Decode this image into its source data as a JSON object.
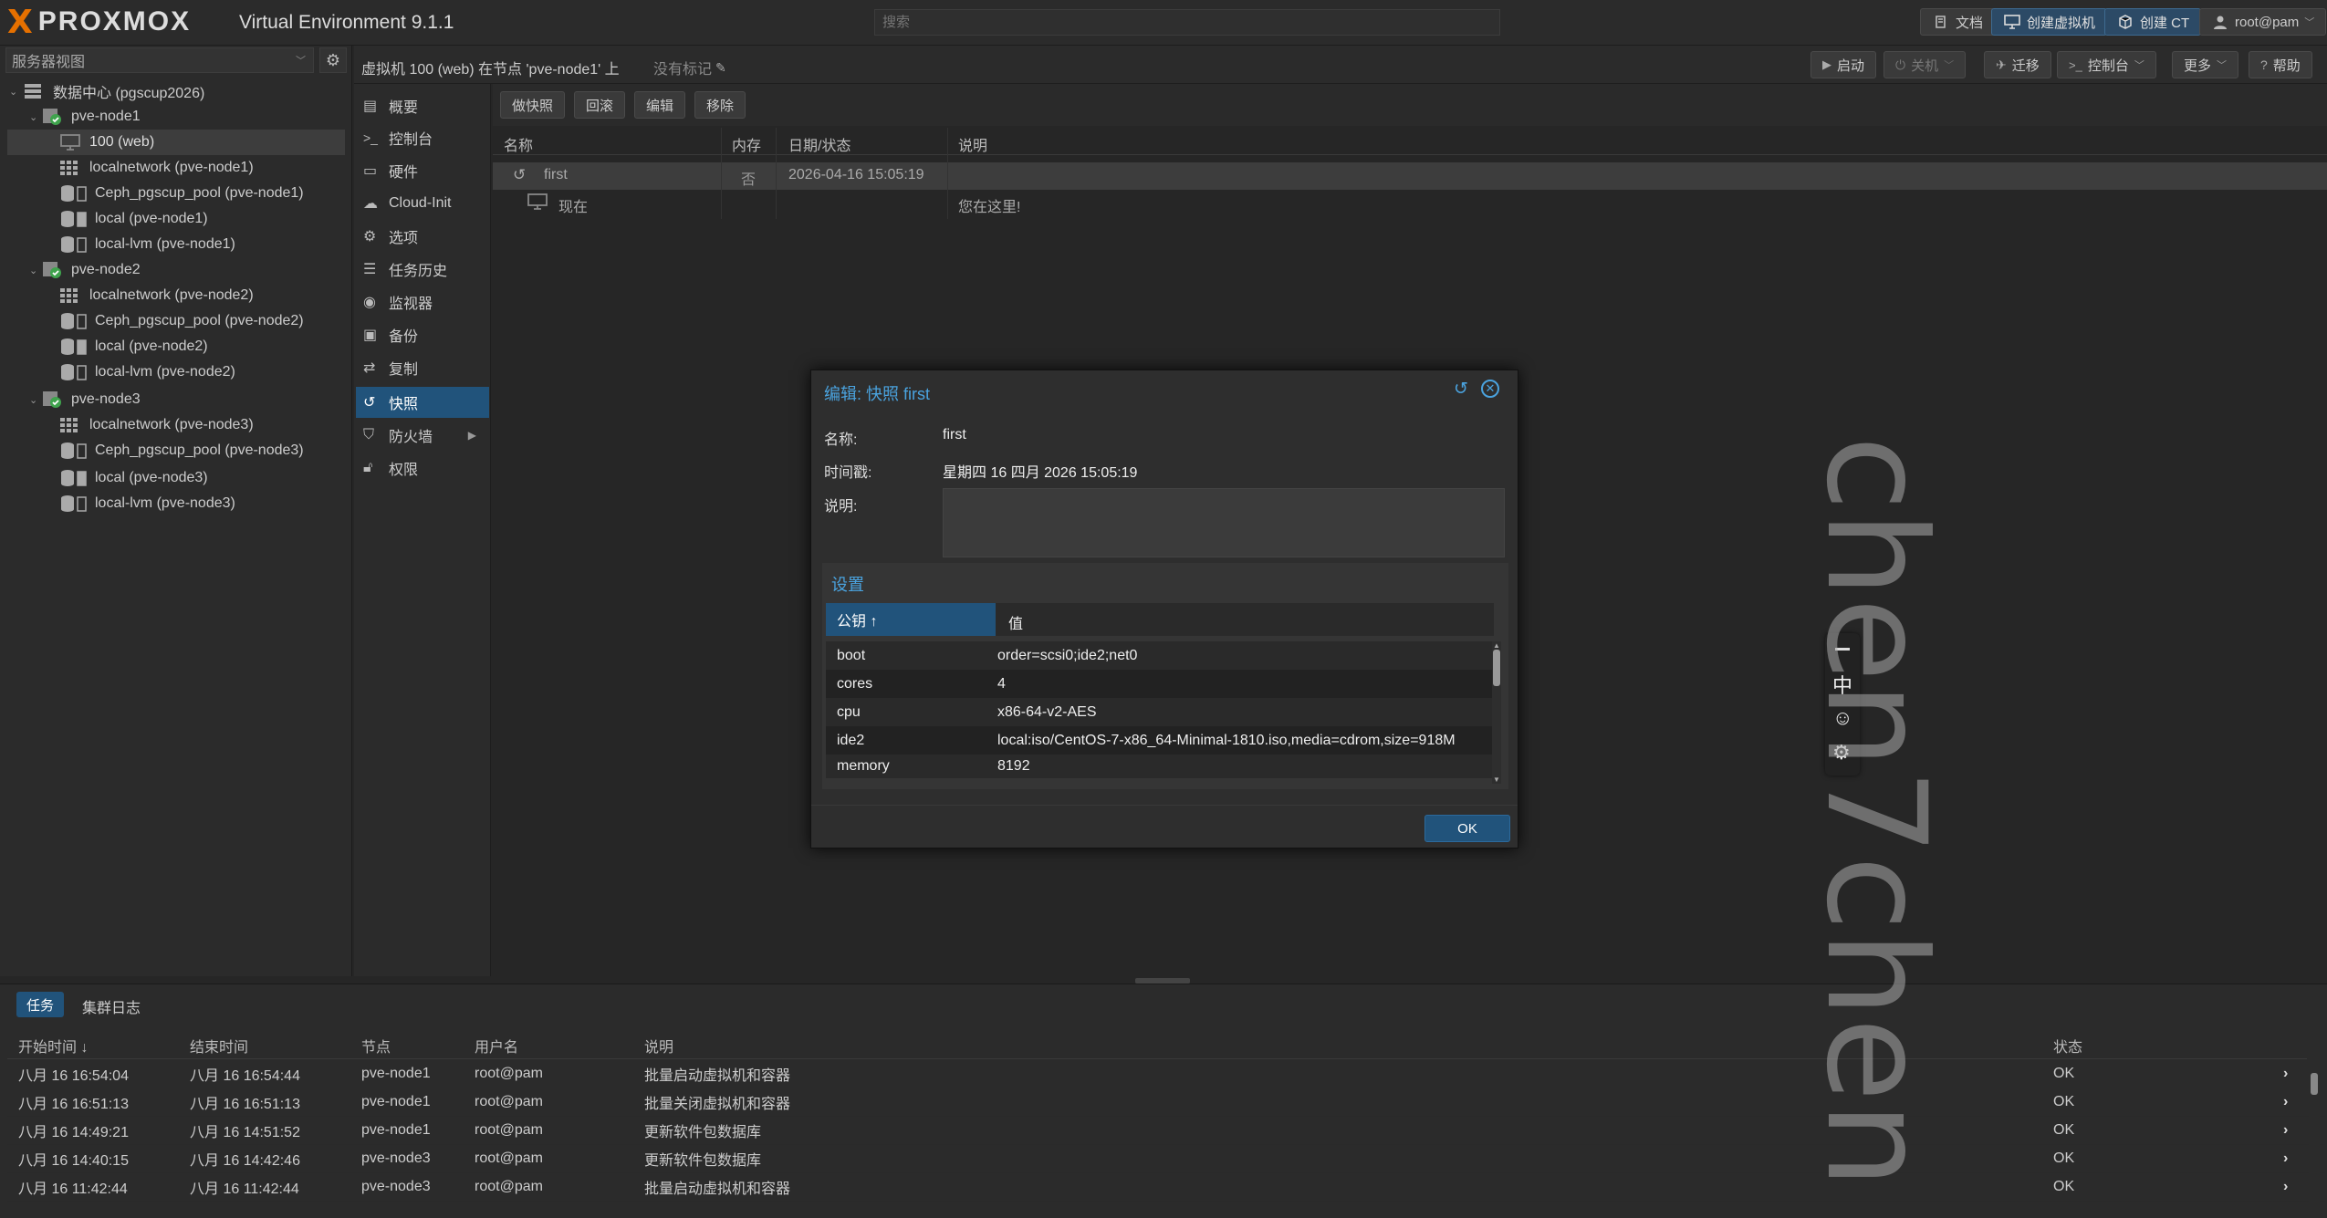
{
  "header": {
    "logo_x": "X",
    "logo_text": "PROXMOX",
    "product": "Virtual Environment 9.1.1",
    "search_placeholder": "搜索",
    "docs_label": "文档",
    "create_vm_label": "创建虚拟机",
    "create_ct_label": "创建 CT",
    "user_label": "root@pam"
  },
  "tree": {
    "view_label": "服务器视图",
    "items": [
      {
        "label": "数据中心 (pgscup2026)"
      },
      {
        "label": "pve-node1"
      },
      {
        "label": "100 (web)"
      },
      {
        "label": "localnetwork (pve-node1)"
      },
      {
        "label": "Ceph_pgscup_pool (pve-node1)"
      },
      {
        "label": "local (pve-node1)"
      },
      {
        "label": "local-lvm (pve-node1)"
      },
      {
        "label": "pve-node2"
      },
      {
        "label": "localnetwork (pve-node2)"
      },
      {
        "label": "Ceph_pgscup_pool (pve-node2)"
      },
      {
        "label": "local (pve-node2)"
      },
      {
        "label": "local-lvm (pve-node2)"
      },
      {
        "label": "pve-node3"
      },
      {
        "label": "localnetwork (pve-node3)"
      },
      {
        "label": "Ceph_pgscup_pool (pve-node3)"
      },
      {
        "label": "local (pve-node3)"
      },
      {
        "label": "local-lvm (pve-node3)"
      }
    ]
  },
  "content_header": {
    "title": "虚拟机 100 (web) 在节点 'pve-node1' 上",
    "tags": "没有标记",
    "start": "启动",
    "shutdown": "关机",
    "migrate": "迁移",
    "console": "控制台",
    "more": "更多",
    "help": "帮助"
  },
  "nav": {
    "items": [
      {
        "label": "概要"
      },
      {
        "label": "控制台"
      },
      {
        "label": "硬件"
      },
      {
        "label": "Cloud-Init"
      },
      {
        "label": "选项"
      },
      {
        "label": "任务历史"
      },
      {
        "label": "监视器"
      },
      {
        "label": "备份"
      },
      {
        "label": "复制"
      },
      {
        "label": "快照"
      },
      {
        "label": "防火墙"
      },
      {
        "label": "权限"
      }
    ]
  },
  "snapshot_toolbar": {
    "take": "做快照",
    "rollback": "回滚",
    "edit": "编辑",
    "remove": "移除"
  },
  "snapshot_table": {
    "columns": [
      "名称",
      "内存",
      "日期/状态",
      "说明"
    ],
    "rows": [
      {
        "name": "first",
        "ram": "否",
        "date": "2026-04-16 15:05:19",
        "desc": ""
      },
      {
        "name": "现在",
        "ram": "",
        "date": "",
        "desc": "您在这里!"
      }
    ]
  },
  "modal": {
    "title": "编辑: 快照 first",
    "name_label": "名称:",
    "name_value": "first",
    "time_label": "时间戳:",
    "time_value": "星期四 16 四月 2026 15:05:19",
    "desc_label": "说明:",
    "settings_title": "设置",
    "col_key": "公钥 ↑",
    "col_value": "值",
    "settings": [
      {
        "k": "boot",
        "v": "order=scsi0;ide2;net0"
      },
      {
        "k": "cores",
        "v": "4"
      },
      {
        "k": "cpu",
        "v": "x86-64-v2-AES"
      },
      {
        "k": "ide2",
        "v": "local:iso/CentOS-7-x86_64-Minimal-1810.iso,media=cdrom,size=918M"
      },
      {
        "k": "memory",
        "v": "8192"
      }
    ],
    "ok": "OK"
  },
  "ime": {
    "lang": "中"
  },
  "watermark": "chen7chen",
  "bottom": {
    "tab_tasks": "任务",
    "tab_cluster_log": "集群日志",
    "columns": {
      "start": "开始时间 ↓",
      "end": "结束时间",
      "node": "节点",
      "user": "用户名",
      "desc": "说明",
      "status": "状态"
    },
    "rows": [
      {
        "start": "八月 16 16:54:04",
        "end": "八月 16 16:54:44",
        "node": "pve-node1",
        "user": "root@pam",
        "desc": "批量启动虚拟机和容器",
        "status": "OK"
      },
      {
        "start": "八月 16 16:51:13",
        "end": "八月 16 16:51:13",
        "node": "pve-node1",
        "user": "root@pam",
        "desc": "批量关闭虚拟机和容器",
        "status": "OK"
      },
      {
        "start": "八月 16 14:49:21",
        "end": "八月 16 14:51:52",
        "node": "pve-node1",
        "user": "root@pam",
        "desc": "更新软件包数据库",
        "status": "OK"
      },
      {
        "start": "八月 16 14:40:15",
        "end": "八月 16 14:42:46",
        "node": "pve-node3",
        "user": "root@pam",
        "desc": "更新软件包数据库",
        "status": "OK"
      },
      {
        "start": "八月 16 11:42:44",
        "end": "八月 16 11:42:44",
        "node": "pve-node3",
        "user": "root@pam",
        "desc": "批量启动虚拟机和容器",
        "status": "OK"
      }
    ]
  },
  "colors": {
    "accent": "#21537b",
    "link": "#4aa3df",
    "node_ok": "#3fa34d"
  }
}
